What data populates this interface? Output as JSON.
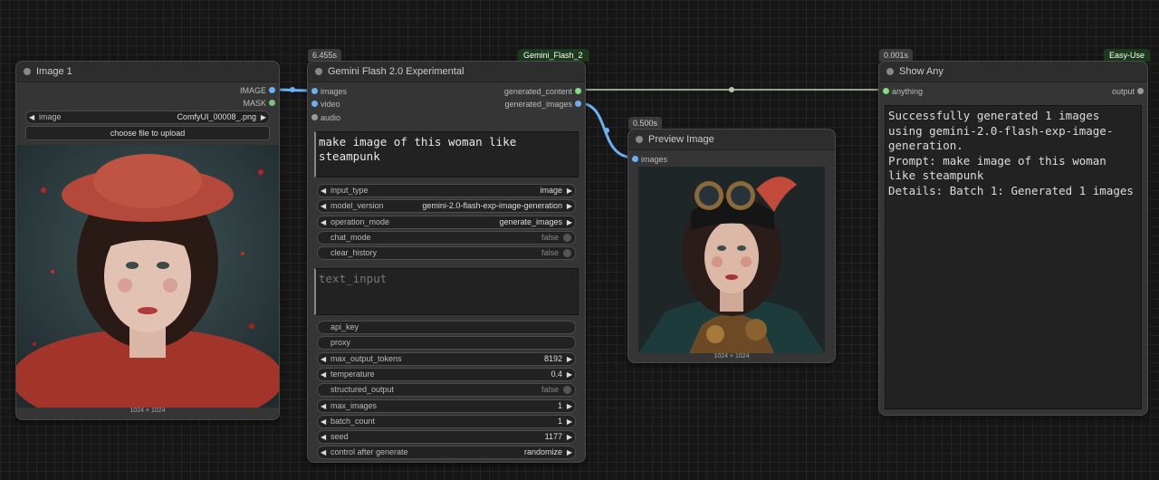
{
  "links_color": "#6ab0f3",
  "node_image": {
    "title": "Image 1",
    "outputs": [
      "IMAGE",
      "MASK"
    ],
    "image_widget": {
      "label": "image",
      "value": "ComfyUI_00008_.png"
    },
    "upload_button": "choose file to upload",
    "dims": "1024 × 1024"
  },
  "node_gemini": {
    "time": "6.455s",
    "tag": "Gemini_Flash_2",
    "title": "Gemini Flash 2.0 Experimental",
    "inputs": [
      "images",
      "video",
      "audio"
    ],
    "outputs": [
      "generated_content",
      "generated_images"
    ],
    "prompt": "make image of this woman like steampunk",
    "widgets_top": [
      {
        "label": "input_type",
        "value": "image",
        "kind": "combo"
      },
      {
        "label": "model_version",
        "value": "gemini-2.0-flash-exp-image-generation",
        "kind": "combo"
      },
      {
        "label": "operation_mode",
        "value": "generate_images",
        "kind": "combo"
      },
      {
        "label": "chat_mode",
        "value": "false",
        "kind": "toggle"
      },
      {
        "label": "clear_history",
        "value": "false",
        "kind": "toggle"
      }
    ],
    "text_input_placeholder": "text_input",
    "widgets_bottom": [
      {
        "label": "api_key",
        "value": "",
        "kind": "text"
      },
      {
        "label": "proxy",
        "value": "",
        "kind": "text"
      },
      {
        "label": "max_output_tokens",
        "value": "8192",
        "kind": "number"
      },
      {
        "label": "temperature",
        "value": "0.4",
        "kind": "number"
      },
      {
        "label": "structured_output",
        "value": "false",
        "kind": "toggle"
      },
      {
        "label": "max_images",
        "value": "1",
        "kind": "number"
      },
      {
        "label": "batch_count",
        "value": "1",
        "kind": "number"
      },
      {
        "label": "seed",
        "value": "1177",
        "kind": "number"
      },
      {
        "label": "control after generate",
        "value": "randomize",
        "kind": "combo"
      }
    ]
  },
  "node_preview": {
    "time": "0.500s",
    "title": "Preview Image",
    "input": "images",
    "dims": "1024 × 1024"
  },
  "node_show": {
    "time": "0.001s",
    "tag": "Easy-Use",
    "title": "Show Any",
    "input": "anything",
    "output": "output",
    "text": "Successfully generated 1 images using gemini-2.0-flash-exp-image-generation.\nPrompt: make image of this woman like steampunk\nDetails: Batch 1: Generated 1 images"
  }
}
